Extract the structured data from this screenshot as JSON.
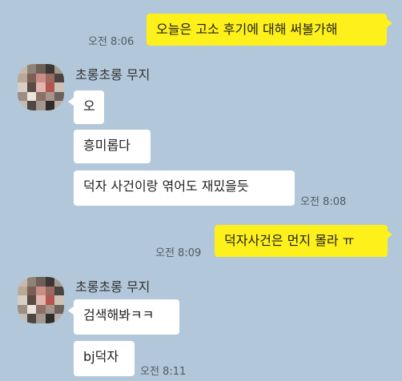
{
  "messages": {
    "m1": {
      "text": "오늘은 고소 후기에 대해 써볼가해",
      "time": "오전 8:06"
    },
    "g1": {
      "sender": "초롱초롱 무지",
      "b1": "오",
      "b2": "흥미롭다",
      "b3": "덕자 사건이랑 엮어도 재밌을듯",
      "time": "오전 8:08"
    },
    "m2": {
      "text": "덕자사건은 먼지 몰라 ㅠ",
      "time": "오전 8:09"
    },
    "g2": {
      "sender": "초롱초롱 무지",
      "b1": "검색해봐ㅋㅋ",
      "b2": "bj덕자",
      "time": "오전 8:11"
    }
  },
  "colors": {
    "background": "#b2c7d9",
    "my_bubble": "#fef01b",
    "other_bubble": "#ffffff"
  }
}
